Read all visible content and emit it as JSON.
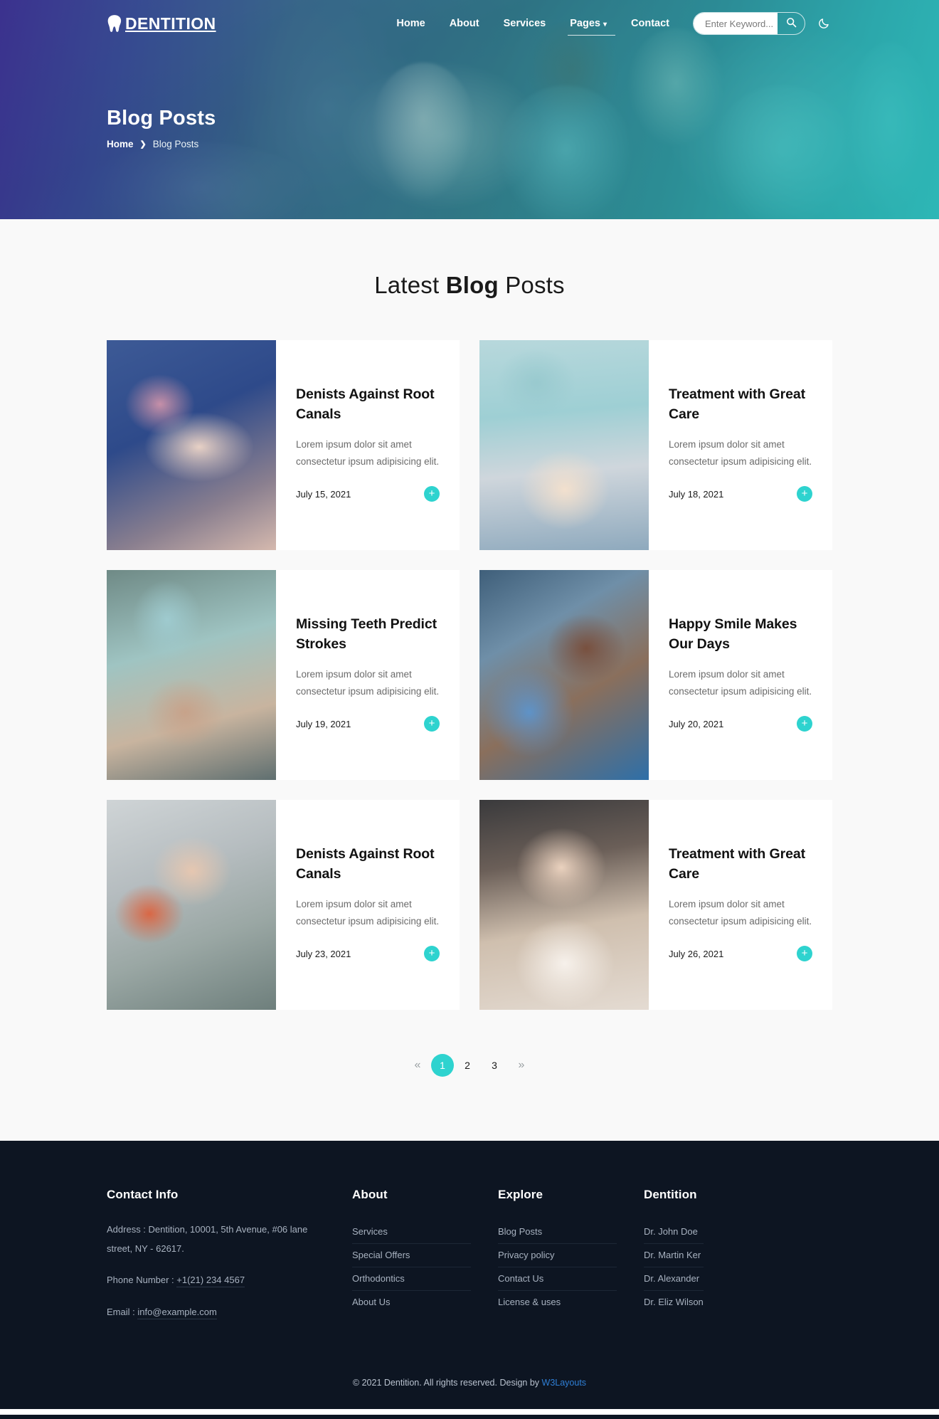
{
  "brand": {
    "name": "DENTITION",
    "icon": "tooth-icon",
    "accent": "#2ed3cf"
  },
  "nav": {
    "items": [
      {
        "label": "Home",
        "active": false
      },
      {
        "label": "About",
        "active": false
      },
      {
        "label": "Services",
        "active": false
      },
      {
        "label": "Pages",
        "active": true,
        "caret": "⌄"
      },
      {
        "label": "Contact",
        "active": false
      }
    ],
    "search": {
      "placeholder": "Enter Keyword...",
      "value": "",
      "icon": "search-icon"
    },
    "theme_toggle": {
      "icon": "moon-icon"
    }
  },
  "hero": {
    "title": "Blog Posts",
    "breadcrumb": {
      "home": "Home",
      "separator": "❯",
      "current": "Blog Posts"
    }
  },
  "section": {
    "title_light": "Latest ",
    "title_bold": "Blog",
    "title_tail": " Posts"
  },
  "posts": [
    {
      "title": "Denists Against Root Canals",
      "desc": "Lorem ipsum dolor sit amet consectetur ipsum adipisicing elit.",
      "date": "July 15, 2021",
      "action": "plus-icon",
      "photo": "p1"
    },
    {
      "title": "Treatment with Great Care",
      "desc": "Lorem ipsum dolor sit amet consectetur ipsum adipisicing elit.",
      "date": "July 18, 2021",
      "action": "plus-icon",
      "photo": "p2"
    },
    {
      "title": "Missing Teeth Predict Strokes",
      "desc": "Lorem ipsum dolor sit amet consectetur ipsum adipisicing elit.",
      "date": "July 19, 2021",
      "action": "plus-icon",
      "photo": "p3"
    },
    {
      "title": "Happy Smile Makes Our Days",
      "desc": "Lorem ipsum dolor sit amet consectetur ipsum adipisicing elit.",
      "date": "July 20, 2021",
      "action": "plus-icon",
      "photo": "p4"
    },
    {
      "title": "Denists Against Root Canals",
      "desc": "Lorem ipsum dolor sit amet consectetur ipsum adipisicing elit.",
      "date": "July 23, 2021",
      "action": "plus-icon",
      "photo": "p5"
    },
    {
      "title": "Treatment with Great Care",
      "desc": "Lorem ipsum dolor sit amet consectetur ipsum adipisicing elit.",
      "date": "July 26, 2021",
      "action": "plus-icon",
      "photo": "p6"
    }
  ],
  "pagination": {
    "prev": "«",
    "next": "»",
    "pages": [
      "1",
      "2",
      "3"
    ],
    "current": "1"
  },
  "footer": {
    "contact": {
      "heading": "Contact Info",
      "address": "Address : Dentition, 10001, 5th Avenue, #06 lane street, NY - 62617.",
      "phone_label": "Phone Number : ",
      "phone": "+1(21) 234 4567",
      "email_label": "Email : ",
      "email": "info@example.com"
    },
    "columns": [
      {
        "heading": "About",
        "links": [
          "Services",
          "Special Offers",
          "Orthodontics",
          "About Us"
        ]
      },
      {
        "heading": "Explore",
        "links": [
          "Blog Posts",
          "Privacy policy",
          "Contact Us",
          "License & uses"
        ]
      },
      {
        "heading": "Dentition",
        "links": [
          "Dr. John Doe",
          "Dr. Martin Ker",
          "Dr. Alexander",
          "Dr. Eliz Wilson"
        ]
      }
    ],
    "copyright_text": "© 2021 Dentition. All rights reserved. Design by ",
    "copyright_link": "W3Layouts"
  }
}
